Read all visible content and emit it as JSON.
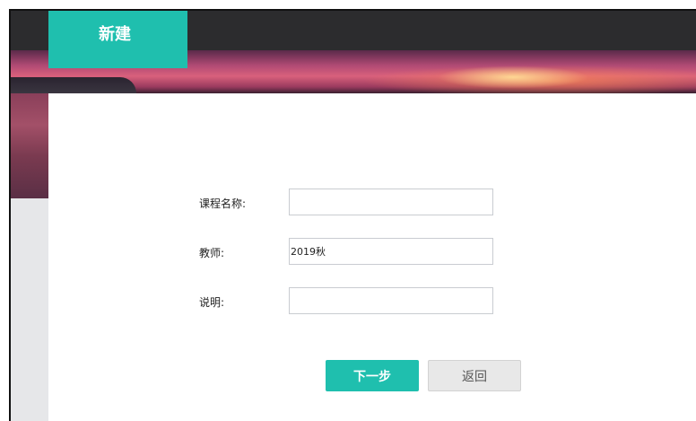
{
  "header": {
    "title": "新建"
  },
  "form": {
    "course_name_label": "课程名称:",
    "course_name_value": "",
    "teacher_label": "教师:",
    "teacher_value": "2019秋",
    "description_label": "说明:",
    "description_value": ""
  },
  "actions": {
    "next_label": "下一步",
    "back_label": "返回"
  },
  "colors": {
    "accent": "#1fbfae",
    "topbar": "#2c2c2e",
    "background": "#e6e7e9"
  }
}
